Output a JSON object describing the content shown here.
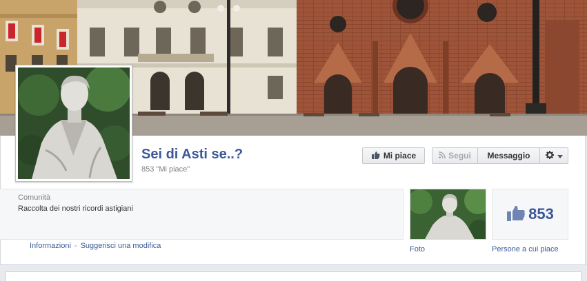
{
  "page": {
    "name": "Sei di Asti se..?",
    "likes_line": "853 \"Mi piace\""
  },
  "actions": {
    "like_label": "Mi piace",
    "follow_label": "Segui",
    "message_label": "Messaggio"
  },
  "about": {
    "category": "Comunità",
    "description": "Raccolta dei nostri ricordi astigiani",
    "links": [
      "Informazioni",
      "Suggerisci una modifica"
    ],
    "separator": "-"
  },
  "apps": {
    "photos_label": "Foto",
    "likes_count": "853",
    "likes_label": "Persone a cui piace"
  },
  "icons": {
    "like": "thumbs-up-icon",
    "follow": "rss-icon",
    "settings": "gear-icon",
    "dropdown": "chevron-down-icon"
  },
  "colors": {
    "brand": "#3b5998",
    "cover_brick": "#8a4a30",
    "cover_facade": "#e8e2d4"
  }
}
